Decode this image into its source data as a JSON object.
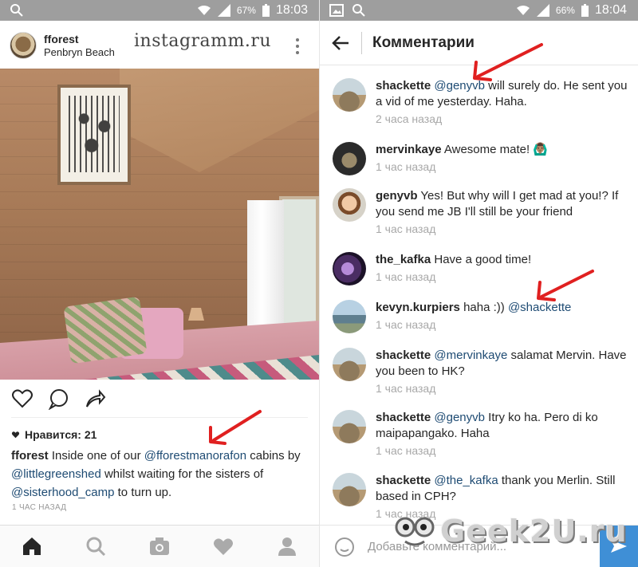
{
  "left_screen": {
    "status_bar": {
      "battery": "67%",
      "time": "18:03"
    },
    "post": {
      "username": "fforest",
      "location": "Penbryn Beach",
      "watermark": "instagramm.ru",
      "likes": "Нравится: 21",
      "caption": {
        "user": "fforest",
        "part1": " Inside one of our ",
        "mention1": "@fforestmanorafon",
        "part2": " cabins by ",
        "mention2": "@littlegreenshed",
        "part3": " whilst waiting for the sisters of ",
        "mention3": "@sisterhood_camp",
        "part4": " to turn up."
      },
      "time_ago": "1 ЧАС НАЗАД"
    },
    "bottom_nav": [
      "home-icon",
      "search-icon",
      "camera-icon",
      "heart-icon",
      "profile-icon"
    ]
  },
  "right_screen": {
    "status_bar": {
      "battery": "66%",
      "time": "18:04"
    },
    "title": "Комментарии",
    "comments": [
      {
        "user": "shackette",
        "mention": "@genyvb",
        "text": " will surely do. He sent you a vid of me yesterday. Haha.",
        "time": "2 часа назад"
      },
      {
        "user": "mervinkaye",
        "mention": "",
        "text": " Awesome mate! 🙆🏽‍♂️",
        "time": "1 час назад"
      },
      {
        "user": "genyvb",
        "mention": "",
        "text": " Yes! But why will I get mad at you!? If you send me JB I'll still be your friend",
        "time": "1 час назад"
      },
      {
        "user": "the_kafka",
        "mention": "",
        "text": " Have a good time!",
        "time": "1 час назад"
      },
      {
        "user": "kevyn.kurpiers",
        "mention": "",
        "text": " haha :)) ",
        "mention_after": "@shackette",
        "time": "1 час назад"
      },
      {
        "user": "shackette",
        "mention": "@mervinkaye",
        "text": " salamat Mervin. Have you been to HK?",
        "time": "1 час назад"
      },
      {
        "user": "shackette",
        "mention": "@genyvb",
        "text": " Itry ko ha. Pero di ko maipapangako. Haha",
        "time": "1 час назад"
      },
      {
        "user": "shackette",
        "mention": "@the_kafka",
        "text": " thank you Merlin. Still based in CPH?",
        "time": "1 час назад"
      }
    ],
    "input_placeholder": "Добавьте комментарий...",
    "site_logo": "Geek2U.ru"
  },
  "colors": {
    "mention": "#1e4b73",
    "arrow": "#e02020",
    "send_button": "#3f8fd6",
    "status_bar": "#9e9e9e"
  }
}
